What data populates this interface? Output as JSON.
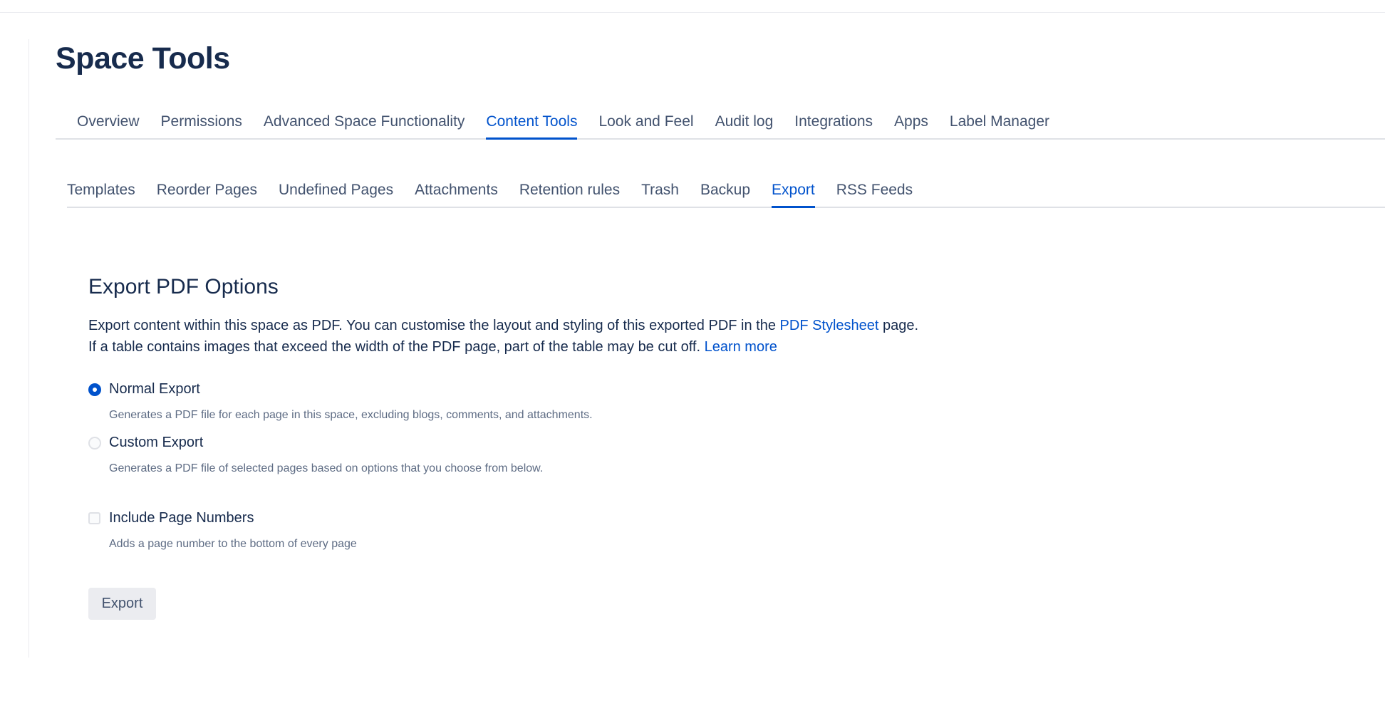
{
  "page_title": "Space Tools",
  "primary_tabs": [
    {
      "label": "Overview"
    },
    {
      "label": "Permissions"
    },
    {
      "label": "Advanced Space Functionality"
    },
    {
      "label": "Content Tools",
      "active": true
    },
    {
      "label": "Look and Feel"
    },
    {
      "label": "Audit log"
    },
    {
      "label": "Integrations"
    },
    {
      "label": "Apps"
    },
    {
      "label": "Label Manager"
    }
  ],
  "secondary_tabs": [
    {
      "label": "Templates"
    },
    {
      "label": "Reorder Pages"
    },
    {
      "label": "Undefined Pages"
    },
    {
      "label": "Attachments"
    },
    {
      "label": "Retention rules"
    },
    {
      "label": "Trash"
    },
    {
      "label": "Backup"
    },
    {
      "label": "Export",
      "active": true
    },
    {
      "label": "RSS Feeds"
    }
  ],
  "export": {
    "title": "Export PDF Options",
    "desc_line1_pre": "Export content within this space as PDF. You can customise the layout and styling of this exported PDF in the ",
    "stylesheet_link": "PDF Stylesheet",
    "desc_line1_post": " page.",
    "desc_line2_pre": "If a table contains images that exceed the width of the PDF page, part of the table may be cut off. ",
    "learn_more_link": "Learn more",
    "normal_label": "Normal Export",
    "normal_hint": "Generates a PDF file for each page in this space, excluding blogs, comments, and attachments.",
    "normal_checked": true,
    "custom_label": "Custom Export",
    "custom_hint": "Generates a PDF file of selected pages based on options that you choose from below.",
    "custom_checked": false,
    "page_numbers_label": "Include Page Numbers",
    "page_numbers_hint": "Adds a page number to the bottom of every page",
    "page_numbers_checked": false,
    "button_label": "Export"
  },
  "colors": {
    "accent": "#0052cc",
    "text": "#172b4d",
    "subtle_text": "#5e6c84",
    "border": "#dfe1e6"
  }
}
